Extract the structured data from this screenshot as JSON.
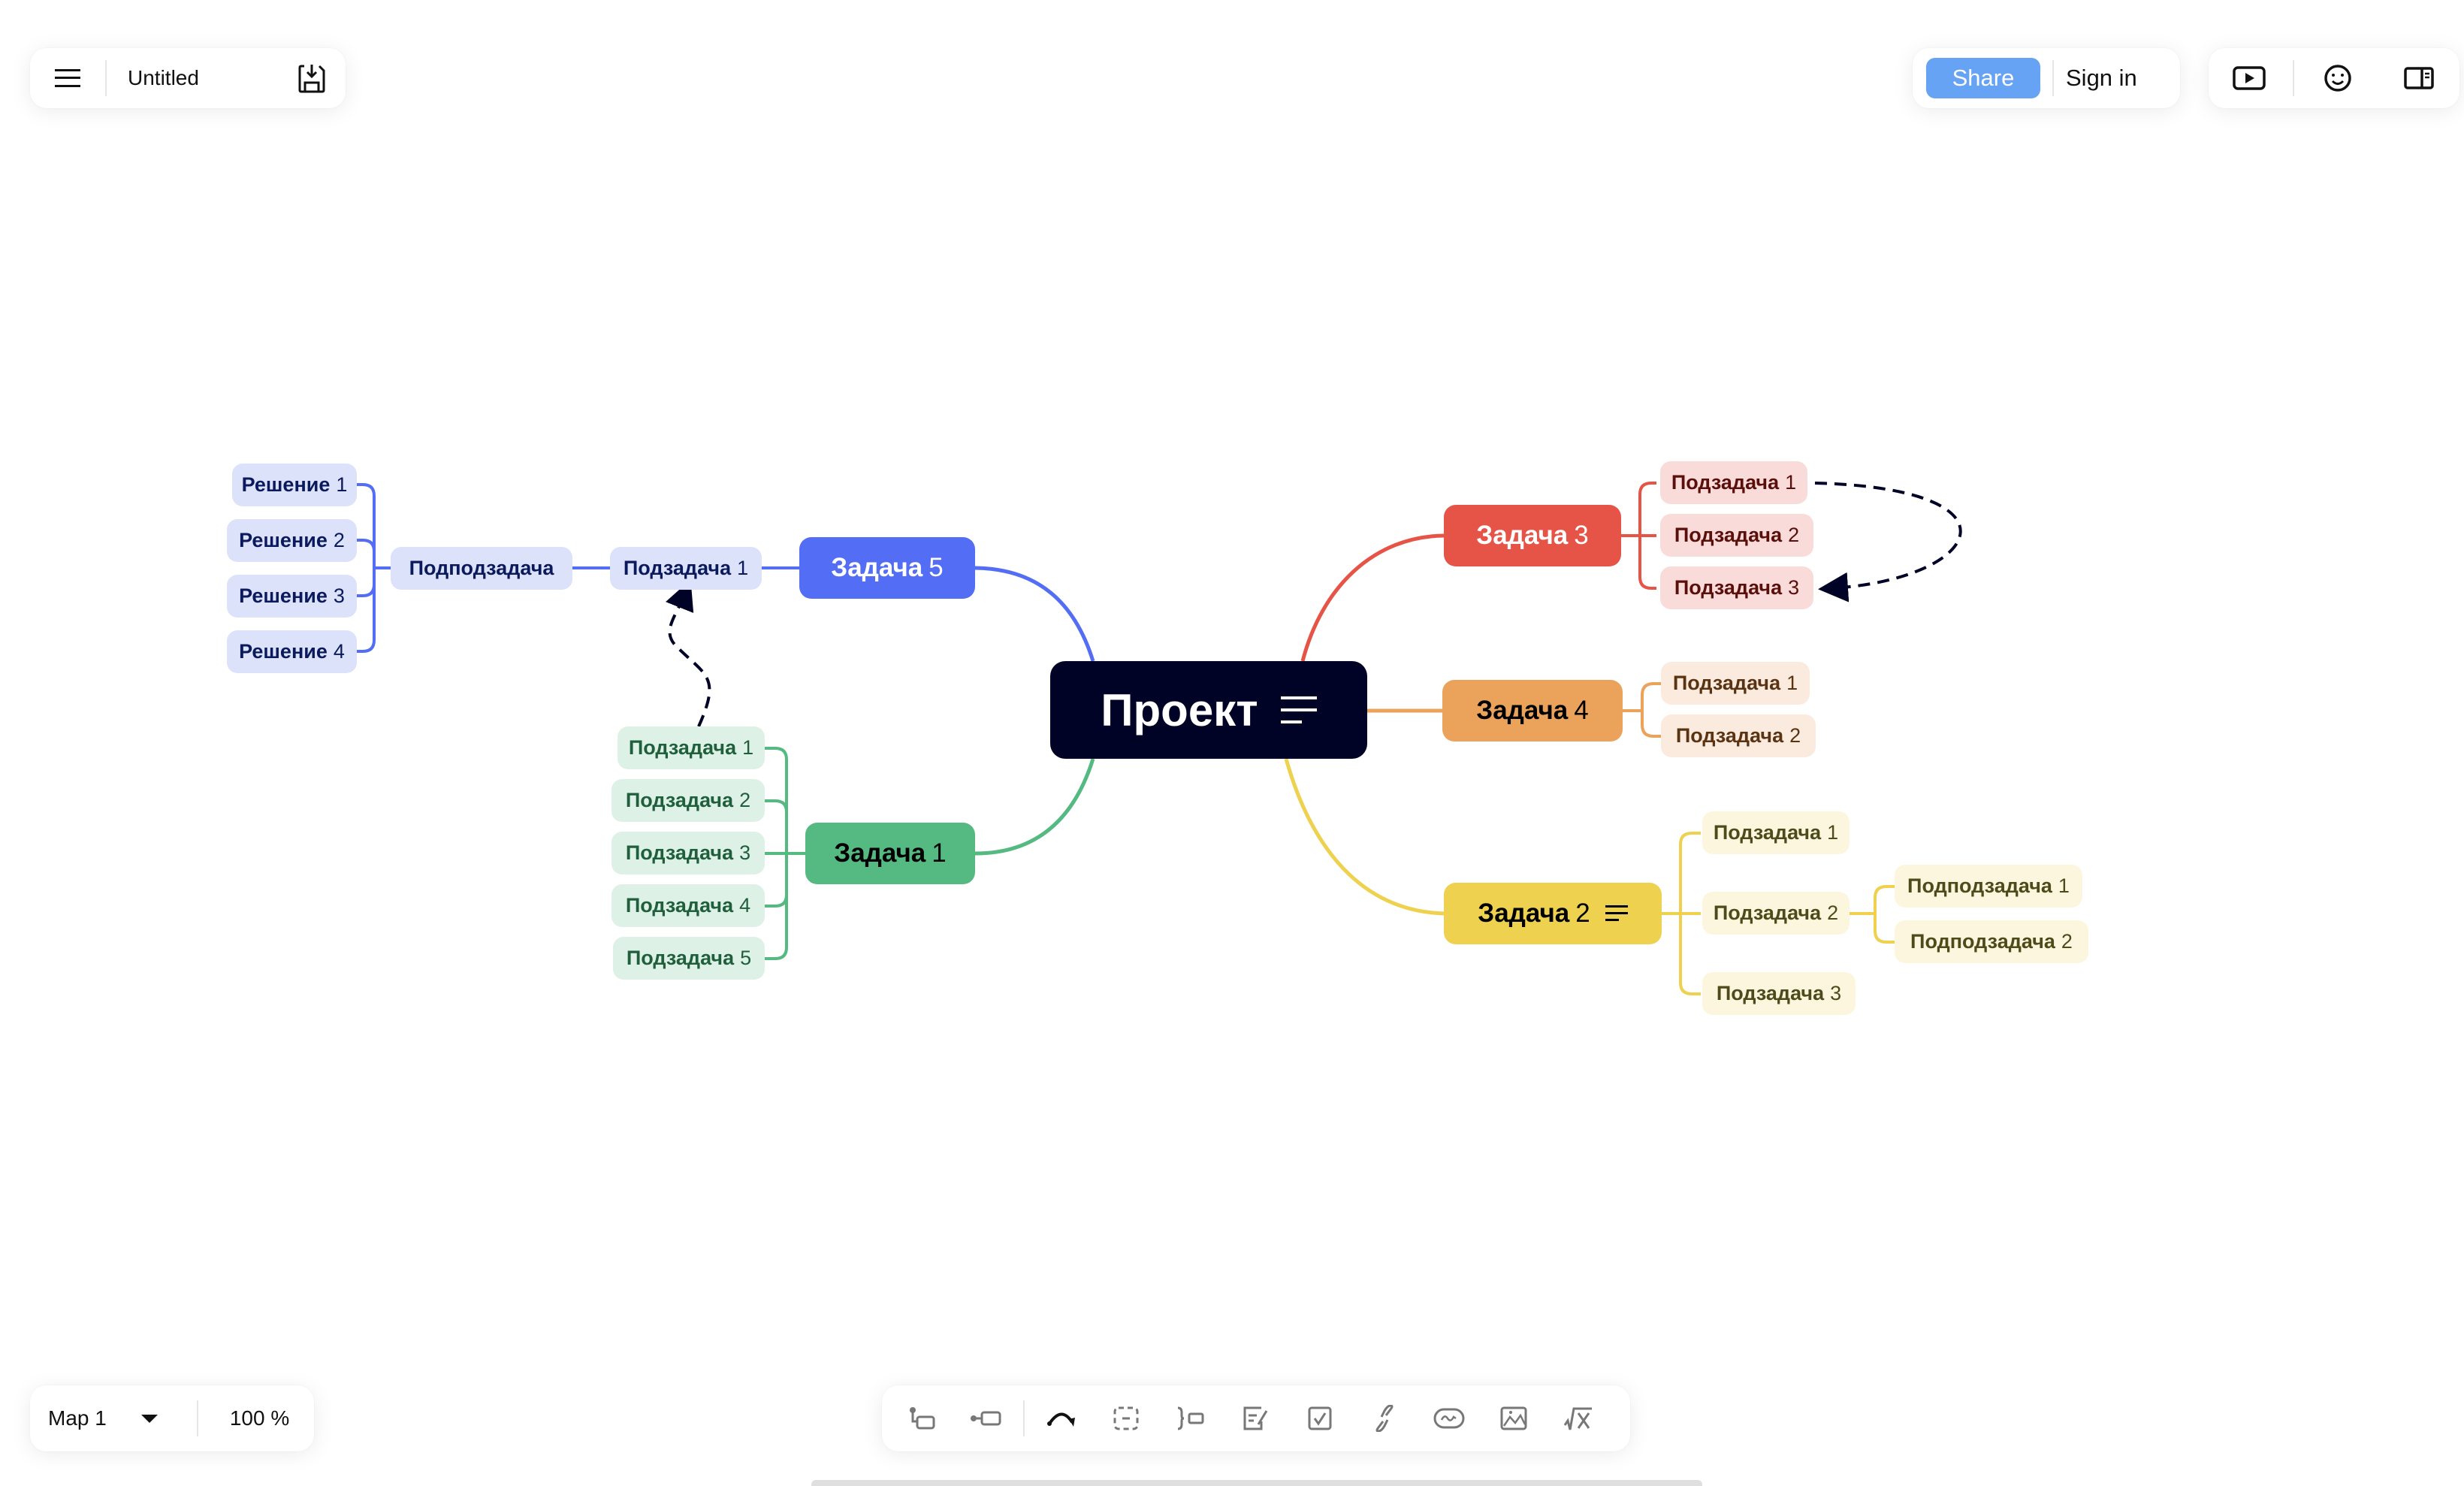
{
  "header": {
    "document_title": "Untitled",
    "share_label": "Share",
    "signin_label": "Sign in",
    "share_color": "#66a3f4"
  },
  "icons": {
    "menu": "hamburger-menu-icon",
    "save": "save-download-icon",
    "present": "play-presentation-icon",
    "emoji": "smiley-face-icon",
    "panel": "sidebar-panel-icon"
  },
  "footer": {
    "map_name": "Map 1",
    "zoom": "100 %"
  },
  "toolbar": {
    "items": [
      "add-child-icon",
      "add-sibling-icon",
      "relationship-arrow-icon",
      "boundary-icon",
      "summary-icon",
      "note-icon",
      "task-checkbox-icon",
      "hyperlink-icon",
      "topic-link-icon",
      "image-icon",
      "equation-icon"
    ]
  },
  "mindmap": {
    "root": {
      "label": "Проект",
      "has_note": true,
      "color": "#000326"
    },
    "branches": {
      "task5": {
        "label": "Задача",
        "num": "5",
        "color": "#536df5",
        "light": "#dde2fb",
        "text": "#0b1a5c",
        "subtask": {
          "label": "Подзадача",
          "num": "1"
        },
        "subsubtask": {
          "label": "Подподзадача"
        },
        "solutions": [
          {
            "label": "Решение",
            "num": "1"
          },
          {
            "label": "Решение",
            "num": "2"
          },
          {
            "label": "Решение",
            "num": "3"
          },
          {
            "label": "Решение",
            "num": "4"
          }
        ]
      },
      "task1": {
        "label": "Задача",
        "num": "1",
        "color": "#55b982",
        "light": "#def1e6",
        "text": "#1f5f3c",
        "subtasks": [
          {
            "label": "Подзадача",
            "num": "1"
          },
          {
            "label": "Подзадача",
            "num": "2"
          },
          {
            "label": "Подзадача",
            "num": "3"
          },
          {
            "label": "Подзадача",
            "num": "4"
          },
          {
            "label": "Подзадача",
            "num": "5"
          }
        ]
      },
      "task3": {
        "label": "Задача",
        "num": "3",
        "color": "#e65448",
        "light": "#f9dcda",
        "text": "#5a0f0b",
        "subtasks": [
          {
            "label": "Подзадача",
            "num": "1"
          },
          {
            "label": "Подзадача",
            "num": "2"
          },
          {
            "label": "Подзадача",
            "num": "3"
          }
        ]
      },
      "task4": {
        "label": "Задача",
        "num": "4",
        "color": "#eba35c",
        "light": "#fbebdf",
        "text": "#5a3412",
        "subtasks": [
          {
            "label": "Подзадача",
            "num": "1"
          },
          {
            "label": "Подзадача",
            "num": "2"
          }
        ]
      },
      "task2": {
        "label": "Задача",
        "num": "2",
        "color": "#edd14f",
        "light": "#fdf6df",
        "text": "#4f4a1a",
        "has_note": true,
        "subtasks": [
          {
            "label": "Подзадача",
            "num": "1"
          },
          {
            "label": "Подзадача",
            "num": "2"
          },
          {
            "label": "Подзадача",
            "num": "3"
          }
        ],
        "subsubtasks": [
          {
            "label": "Подподзадача",
            "num": "1"
          },
          {
            "label": "Подподзадача",
            "num": "2"
          }
        ]
      }
    },
    "relationships": [
      {
        "from": "task1.subtask1",
        "to": "task5.subtask1",
        "style": "dashed"
      },
      {
        "from": "task3.subtask1",
        "to": "task3.subtask3",
        "style": "dashed"
      }
    ]
  }
}
